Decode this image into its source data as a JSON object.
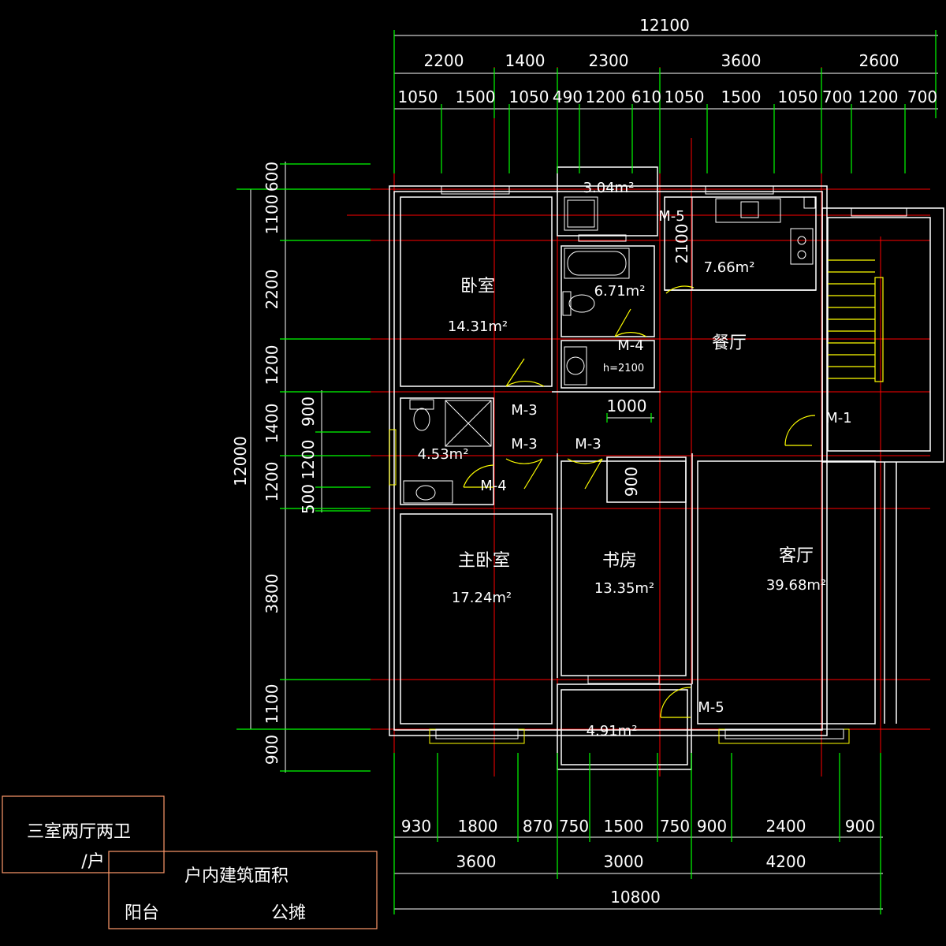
{
  "top_dims": {
    "overall": "12100",
    "row2": [
      "2200",
      "1400",
      "2300",
      "3600",
      "2600"
    ],
    "row3": [
      "1050",
      "1500",
      "1050",
      "490",
      "1200",
      "610",
      "1050",
      "1500",
      "1050",
      "700",
      "1200",
      "700"
    ]
  },
  "left_dims": {
    "overall": "12000",
    "outer": [
      "600",
      "1100",
      "2200",
      "1200",
      "1400",
      "1200",
      "3800",
      "1100",
      "900"
    ],
    "inner": [
      "900",
      "1200",
      "500"
    ]
  },
  "bottom_dims": {
    "row1": [
      "930",
      "1800",
      "870",
      "750",
      "1500",
      "750",
      "900",
      "2400",
      "900"
    ],
    "row2": [
      "3600",
      "3000",
      "4200"
    ],
    "overall": "10800"
  },
  "rooms": {
    "bedroom": {
      "name": "卧室",
      "area": "14.31m²"
    },
    "master_bedroom": {
      "name": "主卧室",
      "area": "17.24m²"
    },
    "study": {
      "name": "书房",
      "area": "13.35m²"
    },
    "living": {
      "name": "客厅",
      "area": "39.68m²"
    },
    "dining": {
      "name": "餐厅"
    },
    "kitchen": {
      "area": "7.66m²"
    },
    "bath_main": {
      "area": "6.71m²"
    },
    "bath_small": {
      "area": "4.53m²"
    },
    "utility": {
      "area": "3.04m²"
    },
    "balcony": {
      "area": "4.91m²"
    }
  },
  "doors": {
    "m5_top": "M-5",
    "m4_upper": "M-4",
    "h_note": "h=2100",
    "m3_a": "M-3",
    "m3_b": "M-3",
    "m3_c": "M-3",
    "m4_lower": "M-4",
    "m1": "M-1",
    "m5_bottom": "M-5"
  },
  "inner_dims": {
    "d1000": "1000",
    "d2100": "2100",
    "d900": "900"
  },
  "title_block": {
    "type": "三室两厅两卫",
    "unit": "/户",
    "area_title": "户内建筑面积",
    "balcony": "阳台",
    "shared": "公摊"
  },
  "colors": {
    "background": "#000000",
    "walls": "#ffffff",
    "axes": "#ff0000",
    "dim_ticks": "#00ff00",
    "doors": "#ffff00",
    "title_block": "#ff9a6a"
  }
}
